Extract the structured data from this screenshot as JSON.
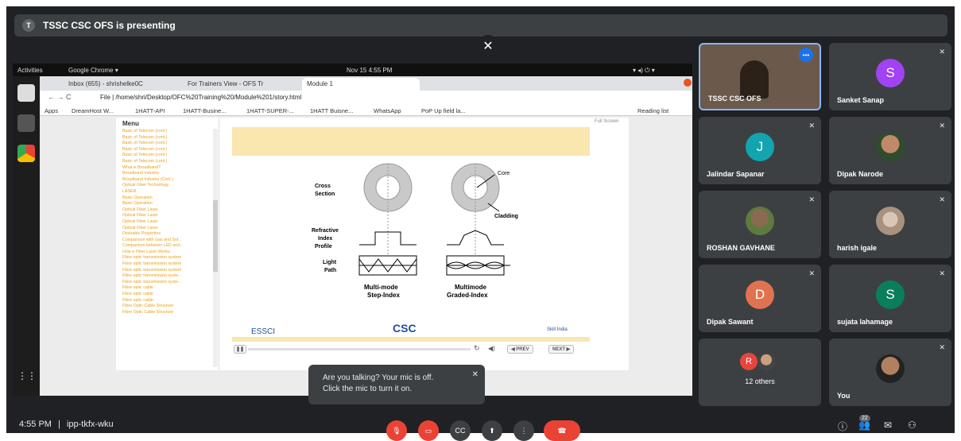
{
  "banner": {
    "avatar_letter": "T",
    "text": "TSSC CSC OFS is presenting"
  },
  "desktop": {
    "activities": "Activities",
    "app": "Google Chrome ▾",
    "clock": "Nov 15  4:55 PM",
    "tabs": [
      "Inbox (655) - shrishelke0C",
      "For Trainers View - OFS Tr",
      "Module 1"
    ],
    "url": "File  |  /home/shri/Desktop/OFC%20Training%20/Module%201/story.html",
    "bookmarks": [
      "Apps",
      "DreamHost W...",
      "1HATT-API",
      "1HATT-Busine...",
      "1HATT-SUPER-...",
      "1HATT Buisne...",
      "WhatsApp",
      "PoP Up field la...",
      "Reading list"
    ],
    "menu_title": "Menu",
    "full_screen": "Full Screen",
    "menu_items": [
      "Basic of Telecom (cont.)",
      "Basic of Telecom (cont.)",
      "Basic of Telecom (cont.)",
      "Basic of Telecom (cont.)",
      "Basic of Telecom (cont.)",
      "Basic of Telecom (cont.)",
      "What is Broadband?",
      "Broadband Industry",
      "Broadband Industry (Cont.)",
      "Optical Fiber Technology",
      "LASER",
      "Basic Operation",
      "Basic Operation",
      "Optical Fiber Laser",
      "Optical Fiber Laser",
      "Optical Fiber Laser",
      "Optical Fiber Laser",
      "Desirable Properties",
      "Comparison with Gas and Sol...",
      "Comparison between LED and...",
      "How a Fiber Laser Works",
      "Fibre optic transmission system",
      "Fibre optic transmission system",
      "Fibre optic transmission system",
      "Fibre optic transmission syste...",
      "Fibre optic transmission syste...",
      "Fibre optic cable",
      "Fibre optic cable",
      "Fibre optic cable",
      "Fibre Optic Cable Structure",
      "Fibre Optic Cable Structure"
    ],
    "slide": {
      "core": "Core",
      "cross_section": [
        "Cross",
        "Section"
      ],
      "cladding": "Cladding",
      "refractive": [
        "Refractive",
        "Index",
        "Profile"
      ],
      "light_path": [
        "Light",
        "Path"
      ],
      "left_caption": [
        "Multi-mode",
        "Step-Index"
      ],
      "right_caption": [
        "Multimode",
        "Graded-Index"
      ],
      "logo_left": "ESSCI",
      "logo_mid": "CSC",
      "logo_right": "Skill India"
    },
    "player": {
      "prev": "◀ PREV",
      "next": "NEXT ▶"
    }
  },
  "toast": {
    "text_line1": "Are you talking? Your mic is off.",
    "text_line2": "Click the mic to turn it on."
  },
  "participants": [
    {
      "name": "TSSC CSC OFS",
      "kind": "video"
    },
    {
      "name": "Sanket Sanap",
      "letter": "S",
      "color": "#a142f4"
    },
    {
      "name": "Jalindar Sapanar",
      "letter": "J",
      "color": "#12a4af"
    },
    {
      "name": "Dipak Narode",
      "kind": "photo"
    },
    {
      "name": "ROSHAN GAVHANE",
      "kind": "photo"
    },
    {
      "name": "harish igale",
      "kind": "photo"
    },
    {
      "name": "Dipak Sawant",
      "letter": "D",
      "color": "#e0734f"
    },
    {
      "name": "sujata lahamage",
      "letter": "S",
      "color": "#0a7e5c"
    },
    {
      "name": "12 others",
      "letter": "R",
      "color": "#e8453c"
    },
    {
      "name": "You",
      "kind": "photo"
    }
  ],
  "bottom": {
    "time": "4:55 PM",
    "separator": "|",
    "meeting_code": "ipp-tkfx-wku",
    "people_count": "22"
  }
}
